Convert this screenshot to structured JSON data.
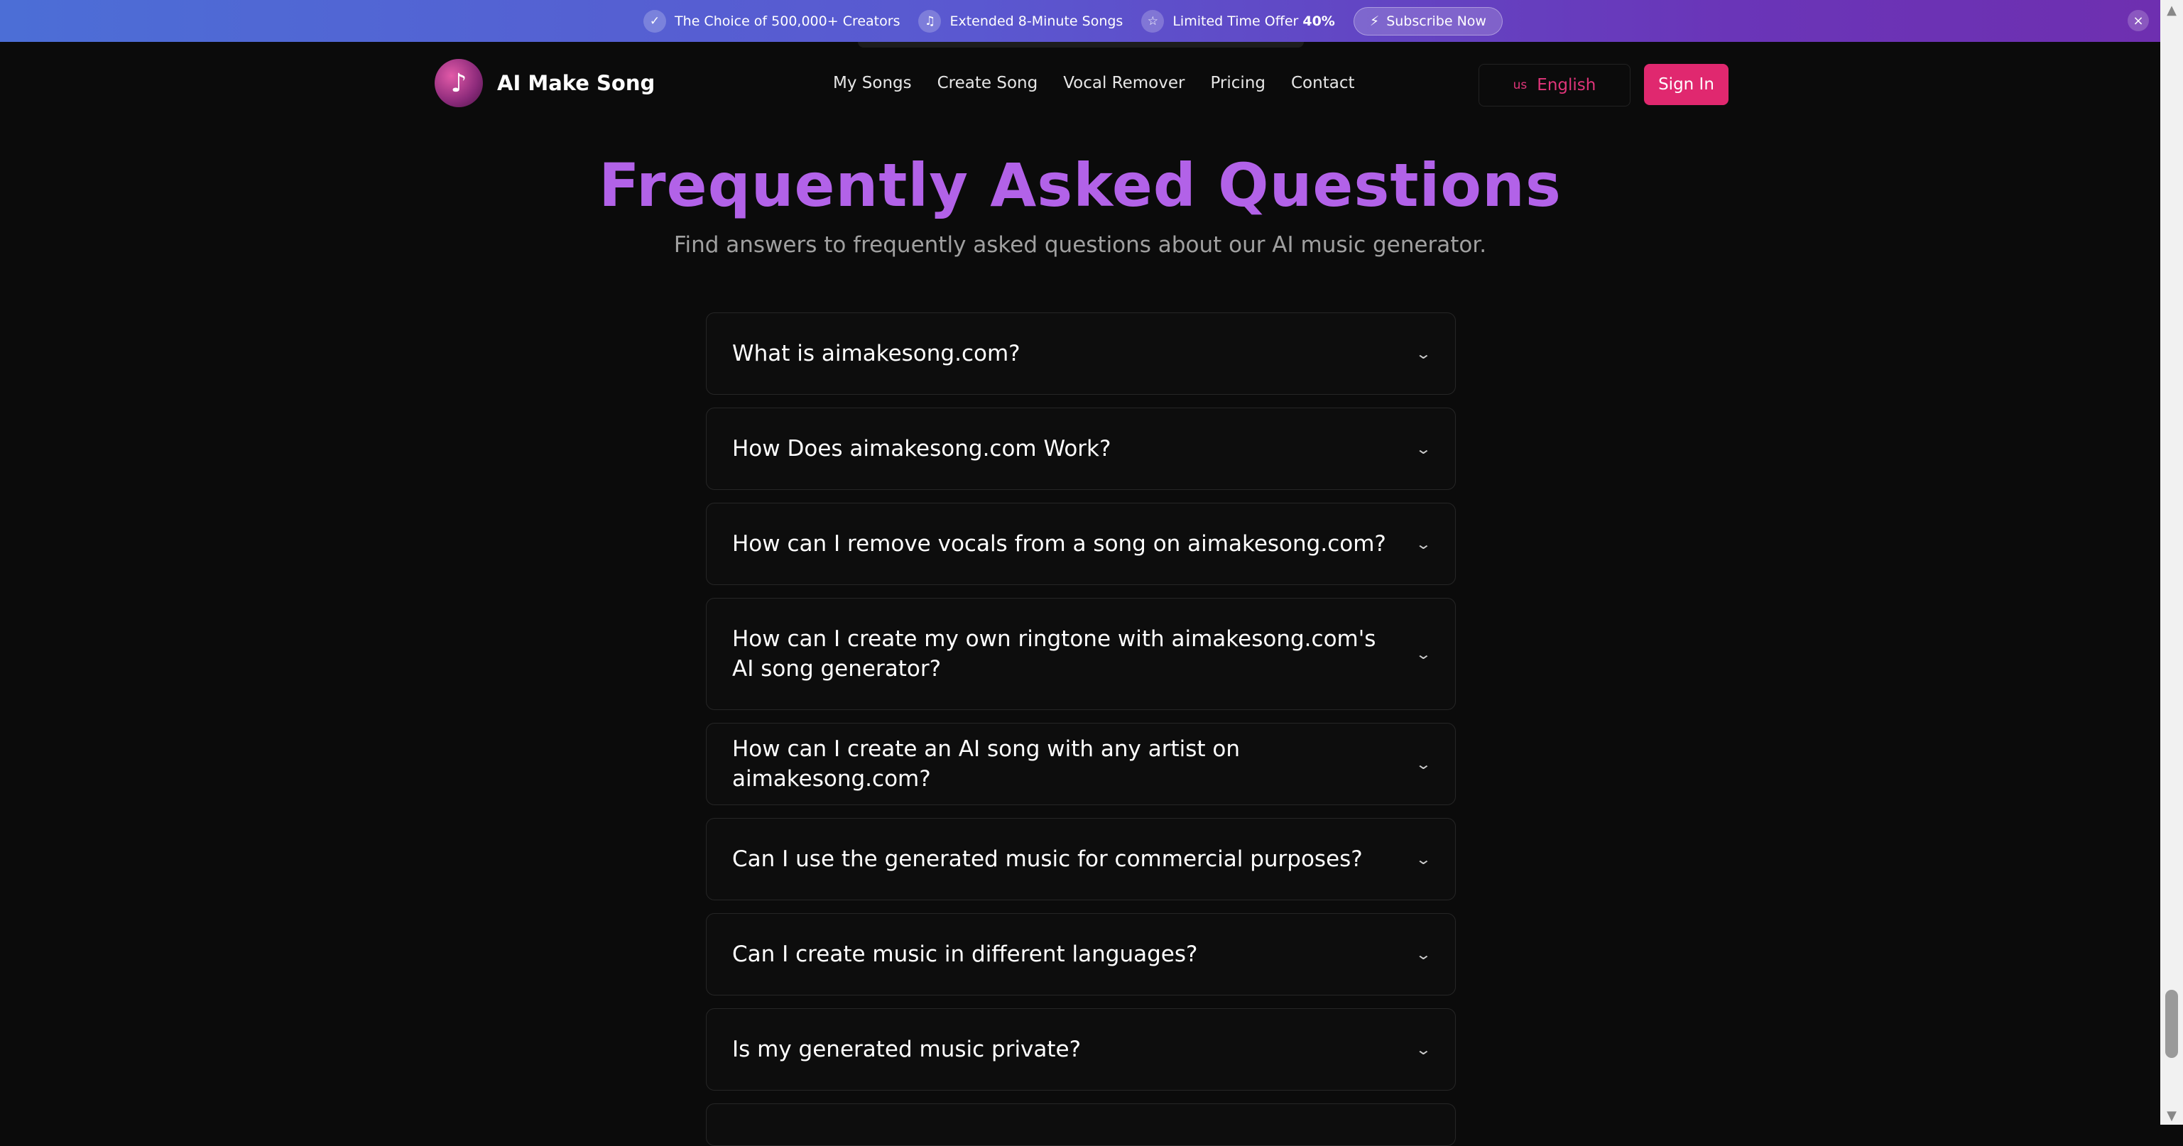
{
  "promo": {
    "item1": "The Choice of 500,000+ Creators",
    "item2": "Extended 8-Minute Songs",
    "item3_text": "Limited Time Offer ",
    "item3_bold": "40%",
    "subscribe": "Subscribe Now",
    "colors": {
      "gradient_start": "#4c6ed6",
      "gradient_end": "#6e2fb0"
    }
  },
  "header": {
    "logo_text": "AI Make Song",
    "nav": [
      "My Songs",
      "Create Song",
      "Vocal Remover",
      "Pricing",
      "Contact"
    ],
    "lang_flag": "us",
    "lang_label": "English",
    "signin": "Sign In",
    "colors": {
      "accent": "#e0286f"
    }
  },
  "faq": {
    "title": "Frequently Asked Questions",
    "subtitle": "Find answers to frequently asked questions about our AI music generator.",
    "title_color": "#b262e8",
    "items": [
      "What is aimakesong.com?",
      "How Does aimakesong.com Work?",
      "How can I remove vocals from a song on aimakesong.com?",
      "How can I create my own ringtone with aimakesong.com's AI song generator?",
      "How can I create an AI song with any artist on aimakesong.com?",
      "Can I use the generated music for commercial purposes?",
      "Can I create music in different languages?",
      "Is my generated music private?"
    ]
  },
  "icons": {
    "promo1": "check-badge-icon",
    "promo2": "music-note-icon",
    "promo3": "star-icon",
    "subscribe": "lightning-icon",
    "close": "close-icon",
    "faq": "chevron-down-icon"
  }
}
